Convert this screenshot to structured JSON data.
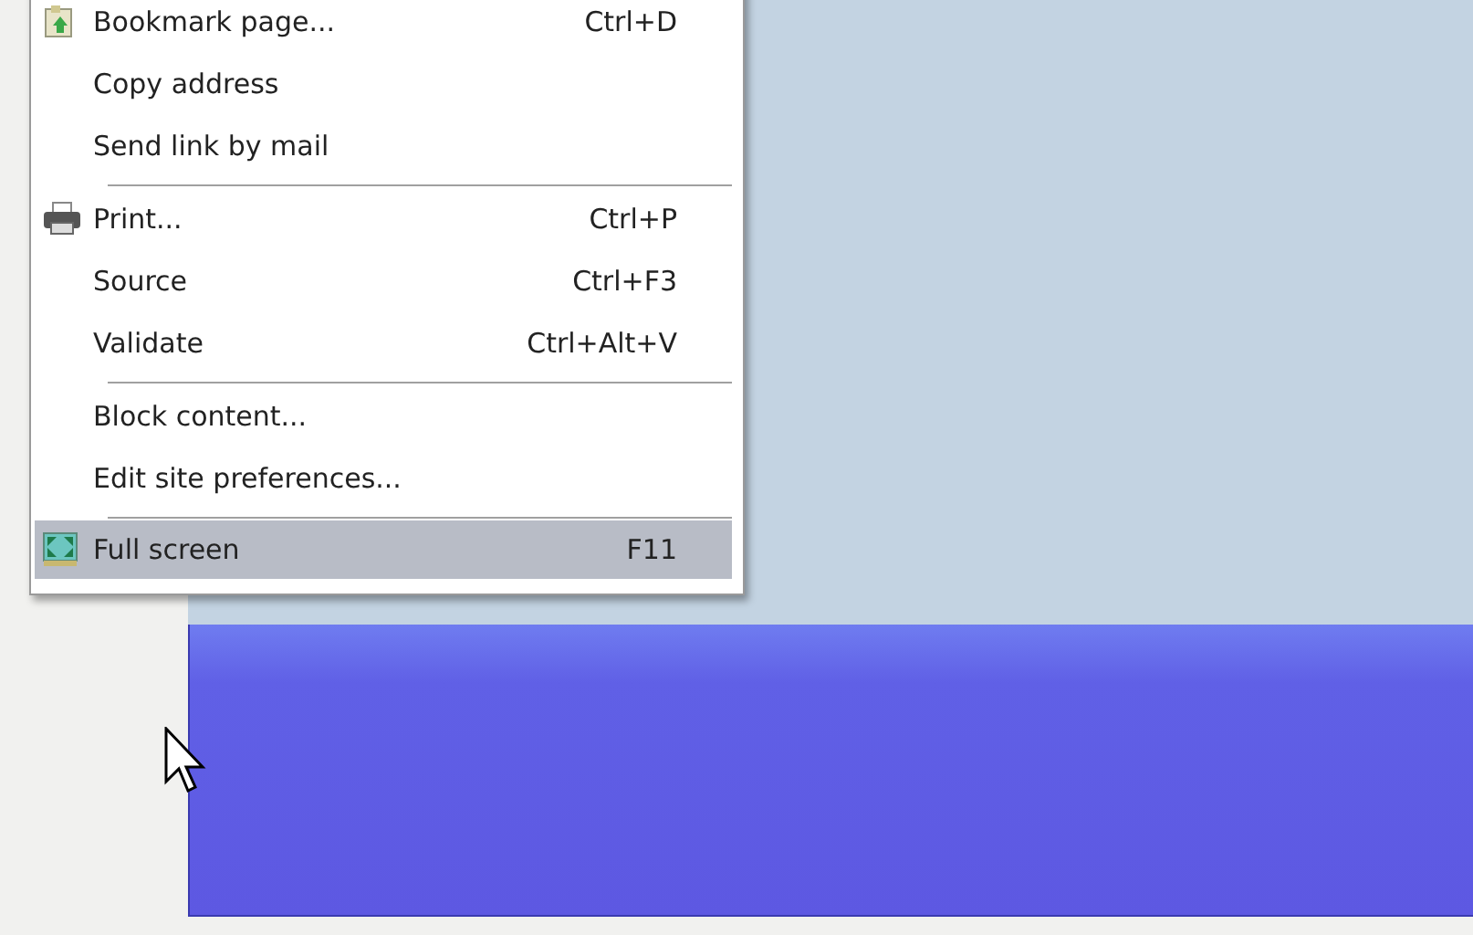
{
  "menu": {
    "items": [
      {
        "kind": "bookmark",
        "label": "Bookmark page...",
        "shortcut": "Ctrl+D",
        "selected": false
      },
      {
        "kind": "plain",
        "label": "Copy address",
        "selected": false
      },
      {
        "kind": "plain",
        "label": "Send link by mail",
        "selected": false
      },
      {
        "kind": "separator"
      },
      {
        "kind": "printer",
        "label": "Print...",
        "shortcut": "Ctrl+P",
        "selected": false
      },
      {
        "kind": "plain",
        "label": "Source",
        "shortcut": "Ctrl+F3",
        "selected": false
      },
      {
        "kind": "plain",
        "label": "Validate",
        "shortcut": "Ctrl+Alt+V",
        "selected": false
      },
      {
        "kind": "separator"
      },
      {
        "kind": "plain",
        "label": "Block content...",
        "selected": false
      },
      {
        "kind": "plain",
        "label": "Edit site preferences...",
        "selected": false
      },
      {
        "kind": "separator"
      },
      {
        "kind": "fullscreen",
        "label": "Full screen",
        "shortcut": "F11",
        "selected": true
      }
    ]
  }
}
